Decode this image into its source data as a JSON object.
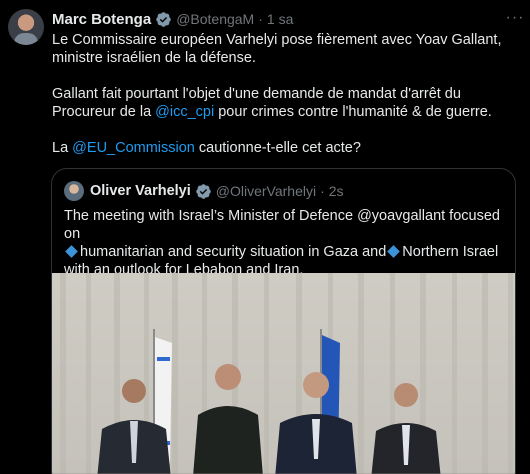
{
  "tweet": {
    "author_name": "Marc Botenga",
    "author_handle": "@BotengaM",
    "separator": "·",
    "time": "1 sa",
    "more_label": "···",
    "paragraph1": "Le Commissaire européen Varhelyi pose fièrement avec Yoav Gallant, ministre israélien de la défense.",
    "paragraph2_pre": "Gallant fait pourtant l'objet d'une demande de mandat d'arrêt du Procureur de la ",
    "paragraph2_link": "@icc_cpi",
    "paragraph2_post": " pour crimes contre l'humanité & de guerre.",
    "paragraph3_pre": "La ",
    "paragraph3_link": "@EU_Commission",
    "paragraph3_post": " cautionne-t-elle cet acte?"
  },
  "quote": {
    "author_name": "Oliver Varhelyi",
    "author_handle": "@OliverVarhelyi",
    "separator": "·",
    "time": "2s",
    "line1": "The meeting with Israel’s Minister of Defence @yoavgallant focused on",
    "line2_a": "humanitarian and security situation in Gaza and",
    "line2_b": "Northern Israel",
    "line3": "with an outlook for Lebabon and Iran."
  },
  "colors": {
    "background": "#000000",
    "text": "#e7e9ea",
    "muted": "#71767b",
    "link": "#1d9bf0",
    "verified": "#829aab",
    "border": "#2f3336"
  },
  "icons": [
    "verified-badge-icon",
    "more-options-icon",
    "small-blue-diamond-icon"
  ]
}
